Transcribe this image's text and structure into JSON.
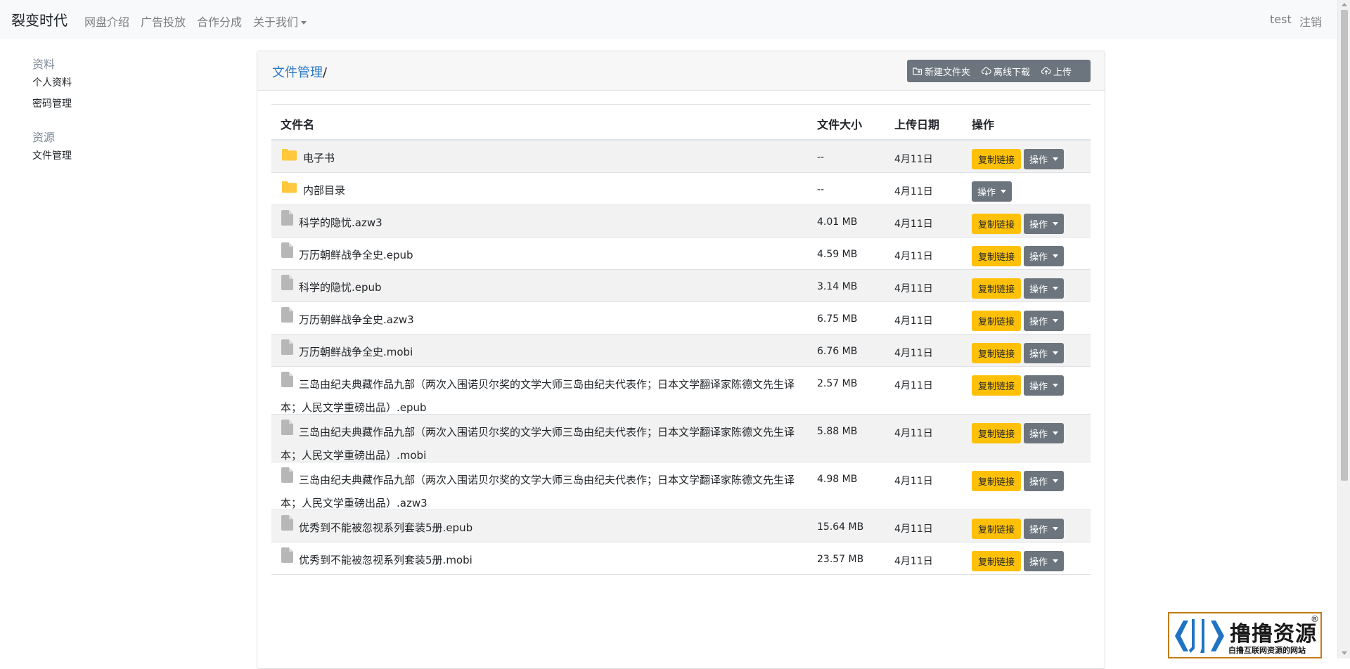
{
  "navbar": {
    "brand": "裂变时代",
    "links": [
      "网盘介绍",
      "广告投放",
      "合作分成",
      "关于我们"
    ],
    "user": "test",
    "logout": "注销"
  },
  "sidebar": {
    "groups": [
      {
        "heading": "资料",
        "items": [
          "个人资料",
          "密码管理"
        ]
      },
      {
        "heading": "资源",
        "items": [
          "文件管理"
        ]
      }
    ]
  },
  "main": {
    "breadcrumb": {
      "link": "文件管理",
      "sep": "/"
    },
    "toolbar": {
      "new_folder": "新建文件夹",
      "offline_download": "离线下载",
      "upload": "上传"
    },
    "table": {
      "headers": {
        "name": "文件名",
        "size": "文件大小",
        "date": "上传日期",
        "ops": "操作"
      },
      "copy_label": "复制链接",
      "op_label": "操作",
      "rows": [
        {
          "name": "电子书",
          "size": "--",
          "date": "4月11日",
          "type": "folder",
          "copy": true
        },
        {
          "name": "内部目录",
          "size": "--",
          "date": "4月11日",
          "type": "folder",
          "copy": false
        },
        {
          "name": "科学的隐忧.azw3",
          "size": "4.01 MB",
          "date": "4月11日",
          "type": "file",
          "copy": true
        },
        {
          "name": "万历朝鲜战争全史.epub",
          "size": "4.59 MB",
          "date": "4月11日",
          "type": "file",
          "copy": true
        },
        {
          "name": "科学的隐忧.epub",
          "size": "3.14 MB",
          "date": "4月11日",
          "type": "file",
          "copy": true
        },
        {
          "name": "万历朝鲜战争全史.azw3",
          "size": "6.75 MB",
          "date": "4月11日",
          "type": "file",
          "copy": true
        },
        {
          "name": "万历朝鲜战争全史.mobi",
          "size": "6.76 MB",
          "date": "4月11日",
          "type": "file",
          "copy": true
        },
        {
          "name": "三岛由纪夫典藏作品九部（两次入围诺贝尔奖的文学大师三岛由纪夫代表作；日本文学翻译家陈德文先生译本；人民文学重磅出品）.epub",
          "size": "2.57 MB",
          "date": "4月11日",
          "type": "file",
          "copy": true
        },
        {
          "name": "三岛由纪夫典藏作品九部（两次入围诺贝尔奖的文学大师三岛由纪夫代表作；日本文学翻译家陈德文先生译本；人民文学重磅出品）.mobi",
          "size": "5.88 MB",
          "date": "4月11日",
          "type": "file",
          "copy": true
        },
        {
          "name": "三岛由纪夫典藏作品九部（两次入围诺贝尔奖的文学大师三岛由纪夫代表作；日本文学翻译家陈德文先生译本；人民文学重磅出品）.azw3",
          "size": "4.98 MB",
          "date": "4月11日",
          "type": "file",
          "copy": true
        },
        {
          "name": "优秀到不能被忽视系列套装5册.epub",
          "size": "15.64 MB",
          "date": "4月11日",
          "type": "file",
          "copy": true
        },
        {
          "name": "优秀到不能被忽视系列套装5册.mobi",
          "size": "23.57 MB",
          "date": "4月11日",
          "type": "file",
          "copy": true
        }
      ]
    }
  },
  "watermark": {
    "title": "撸撸资源",
    "subtitle": "白撸互联网资源的网站",
    "reg": "®"
  },
  "colors": {
    "link": "#2a7ac8",
    "copy_button": "#ffc107",
    "secondary_button": "#6c757d",
    "folder": "#ffc83d",
    "file_icon": "#b7b7b7"
  }
}
